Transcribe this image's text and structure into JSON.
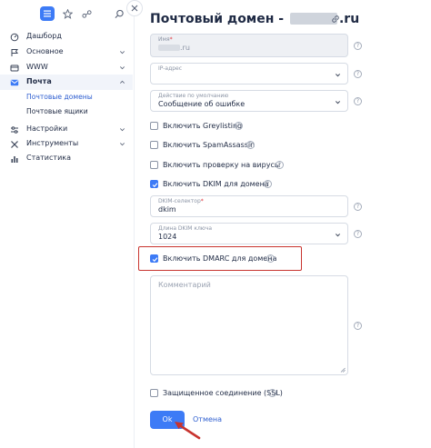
{
  "sidebar": {
    "items": [
      {
        "label": "Дашборд",
        "icon": "dashboard-icon"
      },
      {
        "label": "Основное",
        "icon": "flag-icon"
      },
      {
        "label": "WWW",
        "icon": "globe-icon"
      },
      {
        "label": "Почта",
        "icon": "mail-icon"
      },
      {
        "label": "Настройки",
        "icon": "settings-icon"
      },
      {
        "label": "Инструменты",
        "icon": "tools-icon"
      },
      {
        "label": "Статистика",
        "icon": "stats-icon"
      }
    ],
    "mail_subitems": [
      {
        "label": "Почтовые домены"
      },
      {
        "label": "Почтовые ящики"
      }
    ]
  },
  "page": {
    "title_prefix": "Почтовый домен -",
    "title_suffix": ".ru"
  },
  "form": {
    "name": {
      "label": "Имя",
      "required_mark": "*",
      "value_suffix": ".ru"
    },
    "ip": {
      "label": "IP-адрес",
      "value": ""
    },
    "default_action": {
      "label": "Действие по умолчанию",
      "value": "Сообщение об ошибке"
    },
    "greylisting": {
      "label": "Включить Greylisting",
      "checked": false
    },
    "spamassassin": {
      "label": "Включить SpamAssassin",
      "checked": false
    },
    "antivirus": {
      "label": "Включить проверку на вирусы",
      "checked": false
    },
    "dkim": {
      "label": "Включить DKIM для домена",
      "checked": true
    },
    "dkim_selector": {
      "label": "DKIM-селектор",
      "required_mark": "*",
      "value": "dkim"
    },
    "dkim_length": {
      "label": "Длина DKIM ключа",
      "value": "1024"
    },
    "dmarc": {
      "label": "Включить DMARC для домена",
      "checked": true
    },
    "comment": {
      "placeholder": "Комментарий"
    },
    "ssl": {
      "label": "Защищенное соединение (SSL)",
      "checked": false
    },
    "help_glyph": "?"
  },
  "actions": {
    "ok_label": "Ok",
    "cancel_label": "Отмена"
  },
  "colors": {
    "accent": "#3d7bf6",
    "highlight": "#c8342f"
  }
}
